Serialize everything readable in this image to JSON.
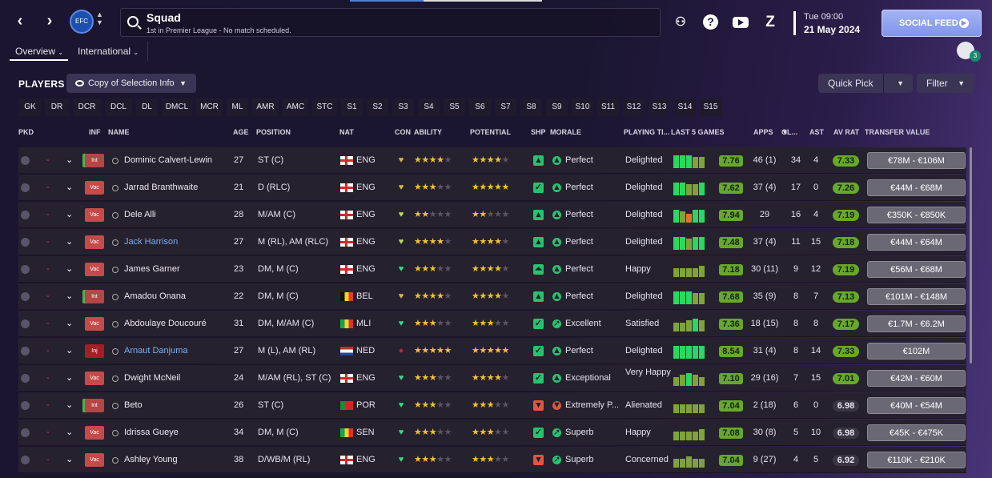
{
  "header": {
    "title": "Squad",
    "subtitle": "1st in Premier League - No match scheduled.",
    "date_time": "Tue 09:00",
    "date": "21 May 2024",
    "social_feed": "SOCIAL FEED",
    "club_crest_text": "EFC",
    "notifications": "3"
  },
  "tabs": [
    "Overview",
    "International"
  ],
  "toolbar": {
    "players_label": "PLAYERS",
    "copy_label": "Copy of Selection Info",
    "quick_pick": "Quick Pick",
    "filter": "Filter"
  },
  "positions": [
    "GK",
    "DR",
    "DCR",
    "DCL",
    "DL",
    "DMCL",
    "MCR",
    "ML",
    "AMR",
    "AMC",
    "STC",
    "S1",
    "S2",
    "S3",
    "S4",
    "S5",
    "S6",
    "S7",
    "S8",
    "S9",
    "S10",
    "S11",
    "S12",
    "S13",
    "S14",
    "S15"
  ],
  "columns": {
    "pkd": "PKD",
    "inf": "INF",
    "name": "NAME",
    "age": "AGE",
    "position": "POSITION",
    "nat": "NAT",
    "con": "CON",
    "ability": "ABILITY",
    "potential": "POTENTIAL",
    "shp": "SHP",
    "morale": "MORALE",
    "playing": "PLAYING TI...",
    "last5": "LAST 5 GAMES",
    "apps": "APPS",
    "gls": "GL...",
    "ast": "AST",
    "avrat": "AV RAT",
    "value": "TRANSFER VALUE"
  },
  "colors": {
    "good": "#67a82a",
    "bar_green": "#28d85f",
    "bar_olive": "#7fa33a",
    "bar_orange": "#d9772c"
  },
  "players": [
    {
      "inf": "Int",
      "name": "Dominic Calvert-Lewin",
      "link": false,
      "age": "27",
      "position": "ST (C)",
      "nat": "ENG",
      "con": "heart-gold",
      "ability": "3.5",
      "potential": "4",
      "shp": "up",
      "morale_icon": "up",
      "morale": "Perfect",
      "playing": "Delighted",
      "bars": [
        {
          "h": 0.9,
          "c": "g"
        },
        {
          "h": 0.9,
          "c": "g"
        },
        {
          "h": 0.9,
          "c": "g"
        },
        {
          "h": 0.75,
          "c": "o"
        },
        {
          "h": 0.75,
          "c": "o"
        }
      ],
      "rating": "7.76",
      "apps": "46 (1)",
      "gls": "34",
      "ast": "4",
      "avrat": "7.33",
      "avgood": true,
      "value": "€78M - €106M"
    },
    {
      "inf": "Vac",
      "name": "Jarrad Branthwaite",
      "link": false,
      "age": "21",
      "position": "D (RLC)",
      "nat": "ENG",
      "con": "heart-gold",
      "ability": "2.5",
      "potential": "4.5w",
      "shp": "check",
      "morale_icon": "up",
      "morale": "Perfect",
      "playing": "Delighted",
      "bars": [
        {
          "h": 0.9,
          "c": "g"
        },
        {
          "h": 0.9,
          "c": "g"
        },
        {
          "h": 0.75,
          "c": "o"
        },
        {
          "h": 0.75,
          "c": "o"
        },
        {
          "h": 0.9,
          "c": "g"
        }
      ],
      "rating": "7.62",
      "apps": "37 (4)",
      "gls": "17",
      "ast": "0",
      "avrat": "7.26",
      "avgood": true,
      "value": "€44M - €68M"
    },
    {
      "inf": "Vac",
      "name": "Dele Alli",
      "link": false,
      "age": "28",
      "position": "M/AM (C)",
      "nat": "ENG",
      "con": "heart-lime",
      "ability": "2",
      "potential": "2",
      "shp": "up",
      "morale_icon": "up",
      "morale": "Perfect",
      "playing": "Delighted",
      "bars": [
        {
          "h": 0.9,
          "c": "g"
        },
        {
          "h": 0.75,
          "c": "o"
        },
        {
          "h": 0.6,
          "c": "r"
        },
        {
          "h": 0.9,
          "c": "g"
        },
        {
          "h": 0.9,
          "c": "g"
        }
      ],
      "rating": "7.94",
      "apps": "29",
      "gls": "16",
      "ast": "4",
      "avrat": "7.19",
      "avgood": true,
      "value": "€350K - €850K"
    },
    {
      "inf": "Vac",
      "name": "Jack Harrison",
      "link": true,
      "age": "27",
      "position": "M (RL), AM (RLC)",
      "nat": "ENG",
      "con": "heart-lime",
      "ability": "3.5",
      "potential": "3.5",
      "shp": "up",
      "morale_icon": "up",
      "morale": "Perfect",
      "playing": "Delighted",
      "bars": [
        {
          "h": 0.9,
          "c": "g"
        },
        {
          "h": 0.9,
          "c": "g"
        },
        {
          "h": 0.75,
          "c": "o"
        },
        {
          "h": 0.9,
          "c": "g"
        },
        {
          "h": 0.9,
          "c": "g"
        }
      ],
      "rating": "7.48",
      "apps": "37 (4)",
      "gls": "11",
      "ast": "15",
      "avrat": "7.18",
      "avgood": true,
      "value": "€44M - €64M"
    },
    {
      "inf": "Vac",
      "name": "James Garner",
      "link": false,
      "age": "23",
      "position": "DM, M (C)",
      "nat": "ENG",
      "con": "heart-green",
      "ability": "3",
      "potential": "3.5",
      "shp": "upup",
      "morale_icon": "up",
      "morale": "Perfect",
      "playing": "Happy",
      "bars": [
        {
          "h": 0.6,
          "c": "o"
        },
        {
          "h": 0.6,
          "c": "o"
        },
        {
          "h": 0.6,
          "c": "o"
        },
        {
          "h": 0.6,
          "c": "o"
        },
        {
          "h": 0.75,
          "c": "o"
        }
      ],
      "rating": "7.18",
      "apps": "30 (11)",
      "gls": "9",
      "ast": "12",
      "avrat": "7.19",
      "avgood": true,
      "value": "€56M - €68M"
    },
    {
      "inf": "Int",
      "name": "Amadou Onana",
      "link": false,
      "age": "22",
      "position": "DM, M (C)",
      "nat": "BEL",
      "con": "heart-gold",
      "ability": "3.5",
      "potential": "3.5",
      "shp": "up",
      "morale_icon": "up",
      "morale": "Perfect",
      "playing": "Delighted",
      "bars": [
        {
          "h": 0.9,
          "c": "g"
        },
        {
          "h": 0.9,
          "c": "g"
        },
        {
          "h": 0.9,
          "c": "g"
        },
        {
          "h": 0.75,
          "c": "o"
        },
        {
          "h": 0.75,
          "c": "o"
        }
      ],
      "rating": "7.68",
      "apps": "35 (9)",
      "gls": "8",
      "ast": "7",
      "avrat": "7.13",
      "avgood": true,
      "value": "€101M - €148M"
    },
    {
      "inf": "Vac",
      "name": "Abdoulaye Doucouré",
      "link": false,
      "age": "31",
      "position": "DM, M/AM (C)",
      "nat": "MLI",
      "con": "heart-green",
      "ability": "3",
      "potential": "3",
      "shp": "check",
      "morale_icon": "right",
      "morale": "Excellent",
      "playing": "Satisfied",
      "bars": [
        {
          "h": 0.6,
          "c": "o"
        },
        {
          "h": 0.6,
          "c": "o"
        },
        {
          "h": 0.75,
          "c": "o"
        },
        {
          "h": 0.9,
          "c": "g"
        },
        {
          "h": 0.75,
          "c": "o"
        }
      ],
      "rating": "7.36",
      "apps": "18 (15)",
      "gls": "8",
      "ast": "8",
      "avrat": "7.17",
      "avgood": true,
      "value": "€1.7M - €6.2M"
    },
    {
      "inf": "Inj",
      "name": "Arnaut Danjuma",
      "link": true,
      "age": "27",
      "position": "M (L), AM (RL)",
      "nat": "NED",
      "con": "dot-red",
      "ability": "4.5",
      "potential": "4.5",
      "shp": "check",
      "morale_icon": "up",
      "morale": "Perfect",
      "playing": "Delighted",
      "bars": [
        {
          "h": 0.9,
          "c": "g"
        },
        {
          "h": 0.9,
          "c": "g"
        },
        {
          "h": 0.9,
          "c": "g"
        },
        {
          "h": 0.9,
          "c": "g"
        },
        {
          "h": 0.9,
          "c": "g"
        }
      ],
      "rating": "8.54",
      "apps": "31 (4)",
      "gls": "8",
      "ast": "14",
      "avrat": "7.33",
      "avgood": true,
      "value": "€102M"
    },
    {
      "inf": "Vac",
      "name": "Dwight McNeil",
      "link": false,
      "age": "24",
      "position": "M/AM (RL), ST (C)",
      "nat": "ENG",
      "con": "heart-green",
      "ability": "3",
      "potential": "3.5",
      "shp": "check",
      "morale_icon": "up",
      "morale": "Exceptional",
      "playing": "Very Happy",
      "bars": [
        {
          "h": 0.6,
          "c": "o"
        },
        {
          "h": 0.75,
          "c": "o"
        },
        {
          "h": 0.9,
          "c": "g"
        },
        {
          "h": 0.75,
          "c": "o"
        },
        {
          "h": 0.6,
          "c": "o"
        }
      ],
      "rating": "7.10",
      "apps": "29 (16)",
      "gls": "7",
      "ast": "15",
      "avrat": "7.01",
      "avgood": true,
      "value": "€42M - €60M"
    },
    {
      "inf": "Int",
      "name": "Beto",
      "link": false,
      "age": "26",
      "position": "ST (C)",
      "nat": "POR",
      "con": "heart-green",
      "ability": "3",
      "potential": "3",
      "shp": "down",
      "morale_icon": "down",
      "morale": "Extremely P...",
      "playing": "Alienated",
      "bars": [
        {
          "h": 0.6,
          "c": "o"
        },
        {
          "h": 0.6,
          "c": "o"
        },
        {
          "h": 0.6,
          "c": "o"
        },
        {
          "h": 0.6,
          "c": "o"
        },
        {
          "h": 0.6,
          "c": "o"
        }
      ],
      "rating": "7.04",
      "apps": "2 (18)",
      "gls": "6",
      "ast": "0",
      "avrat": "6.98",
      "avgood": false,
      "value": "€40M - €54M"
    },
    {
      "inf": "Vac",
      "name": "Idrissa Gueye",
      "link": false,
      "age": "34",
      "position": "DM, M (C)",
      "nat": "SEN",
      "con": "heart-green",
      "ability": "3",
      "potential": "3",
      "shp": "check",
      "morale_icon": "right",
      "morale": "Superb",
      "playing": "Happy",
      "bars": [
        {
          "h": 0.6,
          "c": "o"
        },
        {
          "h": 0.6,
          "c": "o"
        },
        {
          "h": 0.6,
          "c": "o"
        },
        {
          "h": 0.6,
          "c": "o"
        },
        {
          "h": 0.75,
          "c": "o"
        }
      ],
      "rating": "7.08",
      "apps": "30 (8)",
      "gls": "5",
      "ast": "10",
      "avrat": "6.98",
      "avgood": false,
      "value": "€45K - €475K"
    },
    {
      "inf": "Vac",
      "name": "Ashley Young",
      "link": false,
      "age": "38",
      "position": "D/WB/M (RL)",
      "nat": "ENG",
      "con": "heart-green",
      "ability": "2.5",
      "potential": "2.5",
      "shp": "down",
      "morale_icon": "right",
      "morale": "Superb",
      "playing": "Concerned",
      "bars": [
        {
          "h": 0.6,
          "c": "o"
        },
        {
          "h": 0.6,
          "c": "o"
        },
        {
          "h": 0.75,
          "c": "o"
        },
        {
          "h": 0.6,
          "c": "o"
        },
        {
          "h": 0.6,
          "c": "o"
        }
      ],
      "rating": "7.04",
      "apps": "9 (27)",
      "gls": "4",
      "ast": "5",
      "avrat": "6.92",
      "avgood": false,
      "value": "€110K - €210K"
    }
  ]
}
